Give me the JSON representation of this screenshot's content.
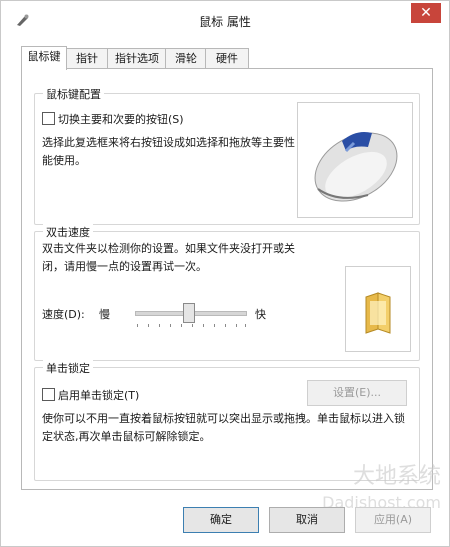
{
  "window": {
    "title": "鼠标 属性",
    "close_label": "✕"
  },
  "tabs": [
    {
      "label": "鼠标键"
    },
    {
      "label": "指针"
    },
    {
      "label": "指针选项"
    },
    {
      "label": "滑轮"
    },
    {
      "label": "硬件"
    }
  ],
  "button_config": {
    "title": "鼠标键配置",
    "checkbox_label": "切换主要和次要的按钮(S)",
    "checked": false,
    "description": "选择此复选框来将右按钮设成如选择和拖放等主要性能使用。"
  },
  "double_click": {
    "title": "双击速度",
    "description": "双击文件夹以检测你的设置。如果文件夹没打开或关闭，请用慢一点的设置再试一次。",
    "speed_label": "速度(D):",
    "slow_label": "慢",
    "fast_label": "快",
    "speed_value": 0.5
  },
  "click_lock": {
    "title": "单击锁定",
    "checkbox_label": "启用单击锁定(T)",
    "checked": false,
    "settings_button": "设置(E)...",
    "description": "使你可以不用一直按着鼠标按钮就可以突出显示或拖拽。单击鼠标以进入锁定状态,再次单击鼠标可解除锁定。"
  },
  "footer": {
    "ok": "确定",
    "cancel": "取消",
    "apply": "应用(A)"
  },
  "watermark": {
    "line1": "大地系统",
    "line2": "Dadishost.com"
  },
  "colors": {
    "close_bg": "#c8453b",
    "default_button_border": "#3c7fb1"
  }
}
